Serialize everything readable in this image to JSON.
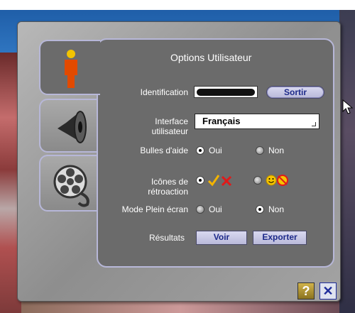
{
  "dialog": {
    "title": "Options Utilisateur",
    "tabs": [
      {
        "name": "user",
        "icon": "user-icon",
        "active": true
      },
      {
        "name": "sound",
        "icon": "speaker-icon",
        "active": false
      },
      {
        "name": "video",
        "icon": "film-reel-icon",
        "active": false
      }
    ],
    "identification": {
      "label": "Identification",
      "logout_button": "Sortir"
    },
    "interface": {
      "label_line1": "Interface",
      "label_line2": "utilisateur",
      "value": "Français"
    },
    "help_bubbles": {
      "label": "Bulles d'aide",
      "option_yes": "Oui",
      "option_no": "Non",
      "selected": "yes"
    },
    "feedback_icons": {
      "label_line1": "Icônes de",
      "label_line2": "rétroaction",
      "selected": "check-cross"
    },
    "fullscreen": {
      "label": "Mode Plein écran",
      "option_yes": "Oui",
      "option_no": "Non",
      "selected": "no"
    },
    "results": {
      "label": "Résultats",
      "view_button": "Voir",
      "export_button": "Exporter"
    },
    "footer": {
      "help_button": "?",
      "close_button": "✕"
    }
  }
}
